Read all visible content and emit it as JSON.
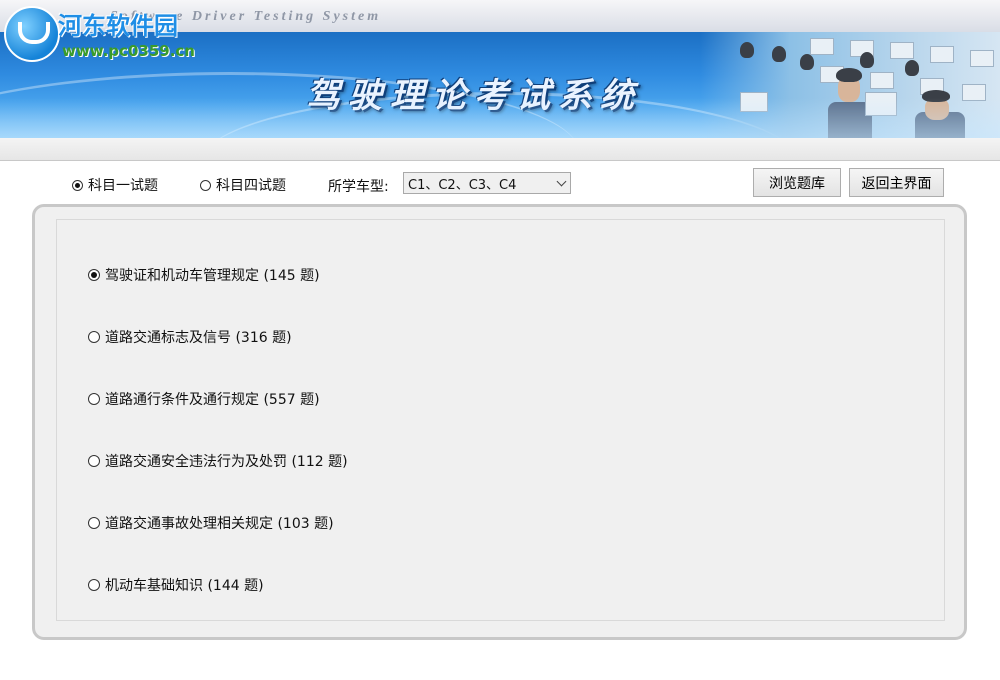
{
  "header": {
    "english_title": "Software Driver Testing System",
    "chinese_title": "驾驶理论考试系统",
    "watermark": {
      "site_name": "河东软件园",
      "url": "www.pc0359.cn"
    }
  },
  "toolbar": {
    "subjects": [
      {
        "label": "科目一试题",
        "checked": true
      },
      {
        "label": "科目四试题",
        "checked": false
      }
    ],
    "car_type_label": "所学车型:",
    "car_type_value": "C1、C2、C3、C4",
    "browse_button": "浏览题库",
    "return_button": "返回主界面"
  },
  "topics": [
    {
      "label": "驾驶证和机动车管理规定 (145 题)",
      "checked": true
    },
    {
      "label": "道路交通标志及信号 (316 题)",
      "checked": false
    },
    {
      "label": "道路通行条件及通行规定 (557 题)",
      "checked": false
    },
    {
      "label": "道路交通安全违法行为及处罚 (112 题)",
      "checked": false
    },
    {
      "label": "道路交通事故处理相关规定 (103 题)",
      "checked": false
    },
    {
      "label": "机动车基础知识 (144 题)",
      "checked": false
    }
  ],
  "colors": {
    "banner_blue": "#2f8be0",
    "title_text": "#eaf3ff",
    "panel_bg": "#f0f0f0",
    "watermark_blue": "#1f8ee6",
    "watermark_green": "#3a9b2b"
  }
}
